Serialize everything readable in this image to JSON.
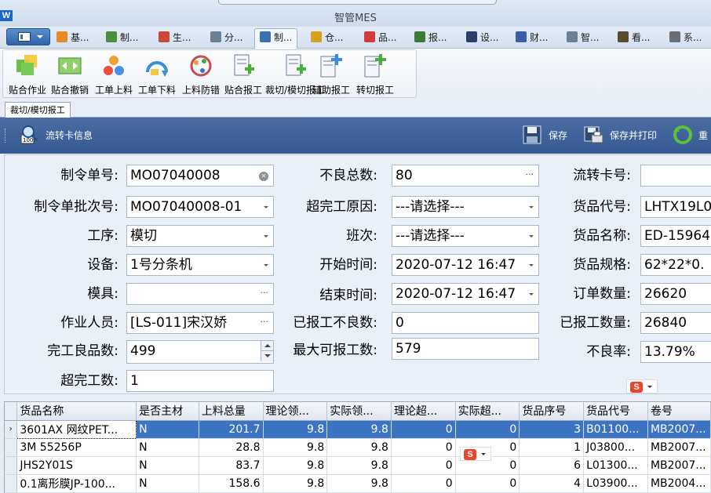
{
  "window": {
    "title": "智管MES",
    "logo": "W"
  },
  "menu_tabs": [
    {
      "label": "基...",
      "icon": "folder-icon",
      "color": "#e58b2a"
    },
    {
      "label": "制...",
      "icon": "chart-icon",
      "color": "#4c8f3a"
    },
    {
      "label": "生...",
      "icon": "calendar-icon",
      "color": "#c8483b"
    },
    {
      "label": "分...",
      "icon": "scissors-icon",
      "color": "#6b7f95"
    },
    {
      "label": "制...",
      "icon": "search-doc-icon",
      "color": "#3d6fb3",
      "active": true
    },
    {
      "label": "仓...",
      "icon": "box-icon",
      "color": "#d8a020"
    },
    {
      "label": "品...",
      "icon": "diamond-icon",
      "color": "#d33a3a"
    },
    {
      "label": "报...",
      "icon": "report-icon",
      "color": "#3a7a3a"
    },
    {
      "label": "设...",
      "icon": "phone-icon",
      "color": "#2c3f66"
    },
    {
      "label": "财...",
      "icon": "tag-icon",
      "color": "#3b5ea8"
    },
    {
      "label": "智...",
      "icon": "signpost-icon",
      "color": "#6b7f95"
    },
    {
      "label": "看...",
      "icon": "monitor-icon",
      "color": "#5a4a2e"
    },
    {
      "label": "系...",
      "icon": "gear-icon",
      "color": "#6b6f75"
    }
  ],
  "ribbon": [
    {
      "label": "贴合作业",
      "icon": "bond-work-icon"
    },
    {
      "label": "贴合撤销",
      "icon": "bond-undo-icon"
    },
    {
      "label": "工单上料",
      "icon": "feed-material-icon"
    },
    {
      "label": "工单下料",
      "icon": "unload-material-icon"
    },
    {
      "label": "上料防错",
      "icon": "error-proof-icon"
    },
    {
      "label": "贴合报工",
      "icon": "bond-report-icon"
    },
    {
      "label": "裁切/模切报工",
      "icon": "cut-report-icon"
    },
    {
      "label": "辅助报工",
      "icon": "aux-report-icon"
    },
    {
      "label": "转切报工",
      "icon": "rotary-report-icon"
    }
  ],
  "doc_tab": "裁切/模切报工",
  "toolbar": {
    "card_info": "流转卡信息",
    "save": "保存",
    "save_print": "保存并打印",
    "reset": "重"
  },
  "form": {
    "order_no": {
      "label": "制令单号:",
      "value": "MO07040008"
    },
    "batch_no": {
      "label": "制令单批次号:",
      "value": "MO07040008-01"
    },
    "process": {
      "label": "工序:",
      "value": "模切"
    },
    "equipment": {
      "label": "设备:",
      "value": "1号分条机"
    },
    "mold": {
      "label": "模具:",
      "value": ""
    },
    "operator": {
      "label": "作业人员:",
      "value": "[LS-011]宋汉娇"
    },
    "good_qty": {
      "label": "完工良品数:",
      "value": "499"
    },
    "over_qty": {
      "label": "超完工数:",
      "value": "1"
    },
    "defect_total": {
      "label": "不良总数:",
      "value": "80"
    },
    "over_reason": {
      "label": "超完工原因:",
      "value": "---请选择---"
    },
    "shift": {
      "label": "班次:",
      "value": "---请选择---"
    },
    "start_time": {
      "label": "开始时间:",
      "value": "2020-07-12 16:47"
    },
    "end_time": {
      "label": "结束时间:",
      "value": "2020-07-12 16:47"
    },
    "reported_defect": {
      "label": "已报工不良数:",
      "value": "0"
    },
    "max_report": {
      "label": "最大可报工数:",
      "value": "579"
    },
    "card_no": {
      "label": "流转卡号:",
      "value": ""
    },
    "item_code": {
      "label": "货品代号:",
      "value": "LHTX19L0"
    },
    "item_name": {
      "label": "货品名称:",
      "value": "ED-15964"
    },
    "item_spec": {
      "label": "货品规格:",
      "value": "62*22*0."
    },
    "order_qty": {
      "label": "订单数量:",
      "value": "26620"
    },
    "reported_qty": {
      "label": "已报工数量:",
      "value": "26840"
    },
    "defect_rate": {
      "label": "不良率:",
      "value": "13.79%"
    }
  },
  "grid": {
    "columns": [
      "货品名称",
      "是否主材",
      "上料总量",
      "理论领...",
      "实际领...",
      "理论超...",
      "实际超...",
      "货品序号",
      "货品代号",
      "卷号"
    ],
    "rows": [
      [
        "3601AX 网纹PET...",
        "N",
        "201.7",
        "9.8",
        "9.8",
        "0",
        "0",
        "3",
        "B01100...",
        "MB2007..."
      ],
      [
        "3M 55256P",
        "N",
        "28.8",
        "9.8",
        "9.8",
        "0",
        "0",
        "1",
        "J03800...",
        "MB2007..."
      ],
      [
        "JHS2Y01S",
        "N",
        "83.7",
        "9.8",
        "9.8",
        "0",
        "0",
        "6",
        "L01300...",
        "MB2007..."
      ],
      [
        "0.1离形膜JP-100...",
        "N",
        "158.6",
        "9.8",
        "9.8",
        "0",
        "0",
        "4",
        "L03900...",
        "MB2004..."
      ]
    ],
    "selected_row": 0
  }
}
